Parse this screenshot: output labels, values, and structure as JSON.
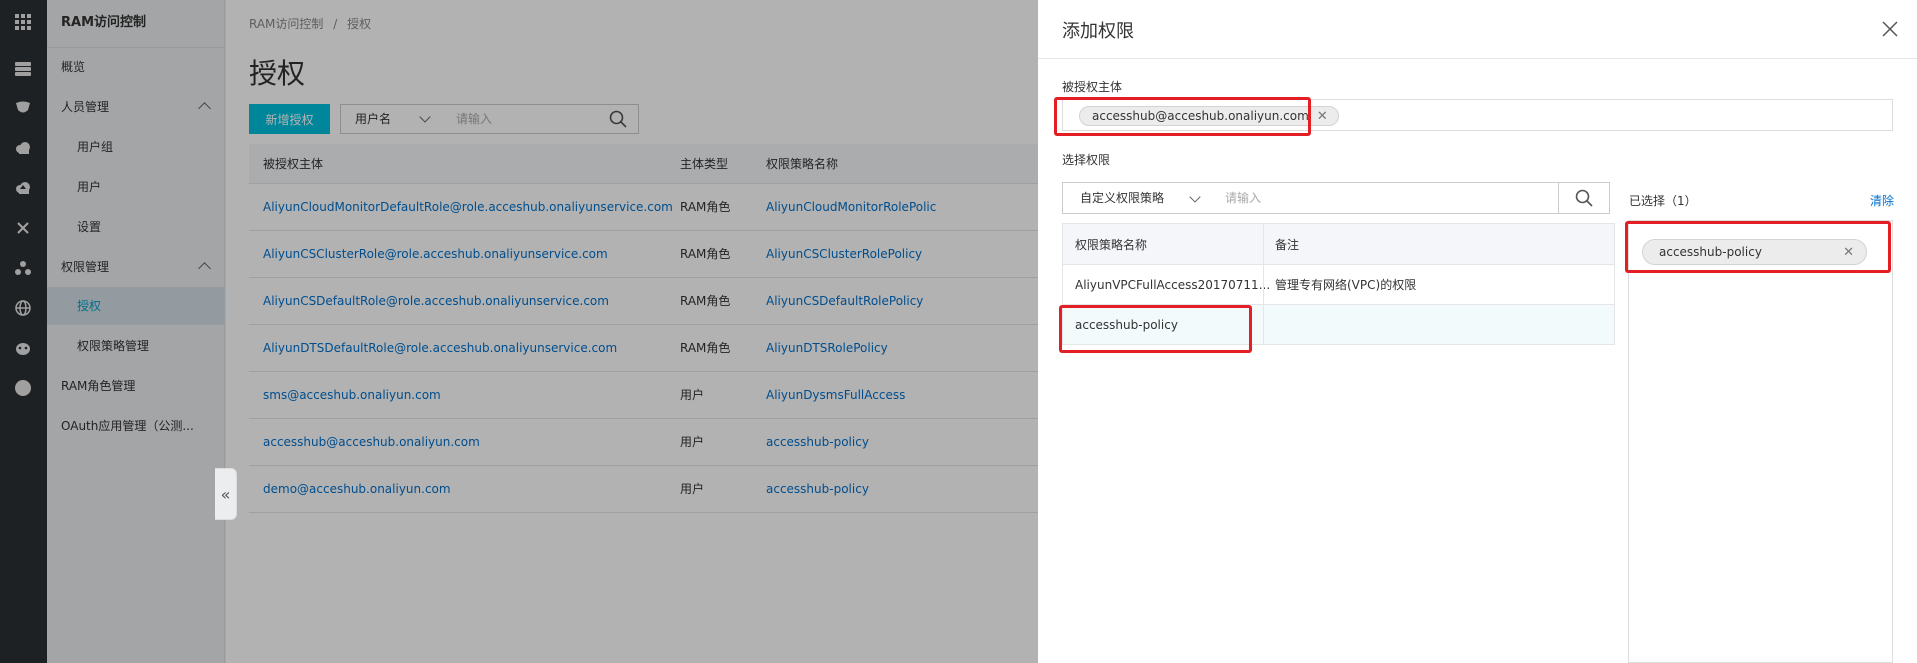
{
  "rail": {
    "icons": [
      "grid-icon",
      "server-icon",
      "shield-icon",
      "cloud-icon",
      "cloud-upload-icon",
      "network-icon",
      "cluster-icon",
      "globe-icon",
      "mascot-icon",
      "circle-icon"
    ]
  },
  "sidebar": {
    "title": "RAM访问控制",
    "items": [
      {
        "label": "概览"
      },
      {
        "label": "人员管理"
      },
      {
        "label": "用户组"
      },
      {
        "label": "用户"
      },
      {
        "label": "设置"
      },
      {
        "label": "权限管理"
      },
      {
        "label": "授权"
      },
      {
        "label": "权限策略管理"
      },
      {
        "label": "RAM角色管理"
      },
      {
        "label": "OAuth应用管理（公测..."
      }
    ],
    "collapse_glyph": "«"
  },
  "main": {
    "breadcrumb": {
      "root": "RAM访问控制",
      "sep": "/",
      "current": "授权"
    },
    "title": "授权",
    "add_button": "新增授权",
    "filter_select": "用户名",
    "search_placeholder": "请输入",
    "table": {
      "headers": [
        "被授权主体",
        "主体类型",
        "权限策略名称"
      ],
      "rows": [
        {
          "principal": "AliyunCloudMonitorDefaultRole@role.acceshub.onaliyunservice.com",
          "type": "RAM角色",
          "policy": "AliyunCloudMonitorRolePolic"
        },
        {
          "principal": "AliyunCSClusterRole@role.acceshub.onaliyunservice.com",
          "type": "RAM角色",
          "policy": "AliyunCSClusterRolePolicy"
        },
        {
          "principal": "AliyunCSDefaultRole@role.acceshub.onaliyunservice.com",
          "type": "RAM角色",
          "policy": "AliyunCSDefaultRolePolicy"
        },
        {
          "principal": "AliyunDTSDefaultRole@role.acceshub.onaliyunservice.com",
          "type": "RAM角色",
          "policy": "AliyunDTSRolePolicy"
        },
        {
          "principal": "sms@acceshub.onaliyun.com",
          "type": "用户",
          "policy": "AliyunDysmsFullAccess"
        },
        {
          "principal": "accesshub@acceshub.onaliyun.com",
          "type": "用户",
          "policy": "accesshub-policy"
        },
        {
          "principal": "demo@acceshub.onaliyun.com",
          "type": "用户",
          "policy": "accesshub-policy"
        }
      ]
    }
  },
  "drawer": {
    "title": "添加权限",
    "principal_label": "被授权主体",
    "principal_tag": "accesshub@acceshub.onaliyun.com",
    "select_label": "选择权限",
    "policy_type": "自定义权限策略",
    "policy_search_placeholder": "请输入",
    "policy_table": {
      "headers": [
        "权限策略名称",
        "备注"
      ],
      "rows": [
        {
          "name": "AliyunVPCFullAccess20170711...",
          "note": "管理专有网络(VPC)的权限"
        },
        {
          "name": "accesshub-policy",
          "note": ""
        }
      ]
    },
    "selected_label": "已选择（1）",
    "clear": "清除",
    "selected_tag": "accesshub-policy"
  },
  "colors": {
    "accent": "#00c1de",
    "link": "#0070cc",
    "highlight": "#e31e25",
    "rail": "#2c3033"
  }
}
